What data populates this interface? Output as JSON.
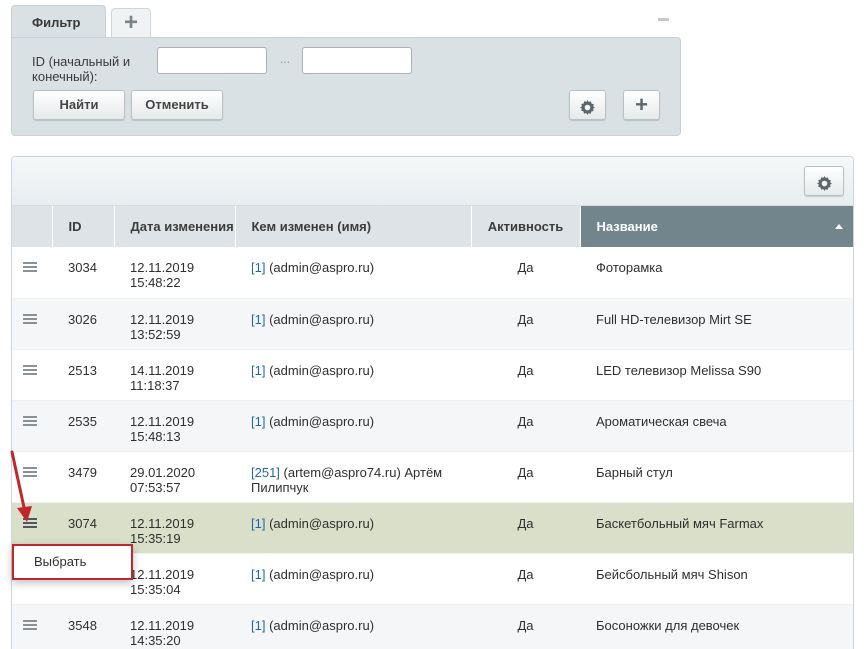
{
  "filter": {
    "tab_label": "Фильтр",
    "add_tab_icon": "plus-icon",
    "id_label": "ID (начальный и конечный):",
    "id_from_value": "",
    "id_to_value": "",
    "range_separator": "...",
    "find_label": "Найти",
    "cancel_label": "Отменить"
  },
  "grid": {
    "columns": [
      "",
      "ID",
      "Дата изменения",
      "Кем изменен (имя)",
      "Активность",
      "Название"
    ],
    "sorted_column": "Название",
    "rows": [
      {
        "id": "3034",
        "date": "12.11.2019",
        "time": "15:48:22",
        "user_id": "[1]",
        "user": " (admin@aspro.ru)",
        "active": "Да",
        "name": "Фоторамка"
      },
      {
        "id": "3026",
        "date": "12.11.2019",
        "time": "13:52:59",
        "user_id": "[1]",
        "user": " (admin@aspro.ru)",
        "active": "Да",
        "name": "Full HD-телевизор Mirt SE"
      },
      {
        "id": "2513",
        "date": "14.11.2019",
        "time": "11:18:37",
        "user_id": "[1]",
        "user": " (admin@aspro.ru)",
        "active": "Да",
        "name": "LED телевизор Melissa S90"
      },
      {
        "id": "2535",
        "date": "12.11.2019",
        "time": "15:48:13",
        "user_id": "[1]",
        "user": " (admin@aspro.ru)",
        "active": "Да",
        "name": "Ароматическая свеча"
      },
      {
        "id": "3479",
        "date": "29.01.2020",
        "time": "07:53:57",
        "user_id": "[251]",
        "user": " (artem@aspro74.ru) Артём Пилипчук",
        "active": "Да",
        "name": "Барный стул"
      },
      {
        "id": "3074",
        "date": "12.11.2019",
        "time": "15:35:19",
        "user_id": "[1]",
        "user": " (admin@aspro.ru)",
        "active": "Да",
        "name": "Баскетбольный мяч Farmax"
      },
      {
        "id": "",
        "date": "12.11.2019",
        "time": "15:35:04",
        "user_id": "[1]",
        "user": " (admin@aspro.ru)",
        "active": "Да",
        "name": "Бейсбольный мяч Shison"
      },
      {
        "id": "3548",
        "date": "12.11.2019",
        "time": "14:35:20",
        "user_id": "[1]",
        "user": " (admin@aspro.ru)",
        "active": "Да",
        "name": "Босоножки для девочек"
      }
    ]
  },
  "context_menu": {
    "select_label": "Выбрать"
  },
  "colors": {
    "accent_border": "#c0272d",
    "sorted_header": "#72848c",
    "hover_row": "#d9dfc8",
    "link": "#2067b0"
  }
}
